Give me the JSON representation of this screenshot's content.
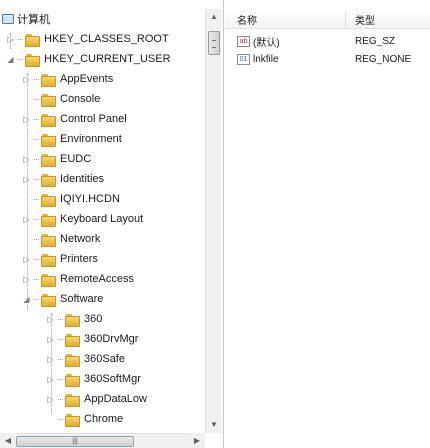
{
  "tree": {
    "root_label": "计算机",
    "items": [
      {
        "label": "HKEY_CLASSES_ROOT",
        "level": 1,
        "twisty": "▷"
      },
      {
        "label": "HKEY_CURRENT_USER",
        "level": 1,
        "twisty": "◢"
      },
      {
        "label": "AppEvents",
        "level": 2,
        "twisty": "▷"
      },
      {
        "label": "Console",
        "level": 2,
        "twisty": ""
      },
      {
        "label": "Control Panel",
        "level": 2,
        "twisty": "▷"
      },
      {
        "label": "Environment",
        "level": 2,
        "twisty": ""
      },
      {
        "label": "EUDC",
        "level": 2,
        "twisty": "▷"
      },
      {
        "label": "Identities",
        "level": 2,
        "twisty": "▷"
      },
      {
        "label": "IQIYI.HCDN",
        "level": 2,
        "twisty": ""
      },
      {
        "label": "Keyboard Layout",
        "level": 2,
        "twisty": "▷"
      },
      {
        "label": "Network",
        "level": 2,
        "twisty": ""
      },
      {
        "label": "Printers",
        "level": 2,
        "twisty": "▷"
      },
      {
        "label": "RemoteAccess",
        "level": 2,
        "twisty": "▷"
      },
      {
        "label": "Software",
        "level": 2,
        "twisty": "◢"
      },
      {
        "label": "360",
        "level": 3,
        "twisty": "▷"
      },
      {
        "label": "360DrvMgr",
        "level": 3,
        "twisty": "▷"
      },
      {
        "label": "360Safe",
        "level": 3,
        "twisty": "▷"
      },
      {
        "label": "360SoftMgr",
        "level": 3,
        "twisty": "▷"
      },
      {
        "label": "AppDataLow",
        "level": 3,
        "twisty": "▷"
      },
      {
        "label": "Chrome",
        "level": 3,
        "twisty": ""
      }
    ],
    "hscroll_grip": "|||"
  },
  "list": {
    "headers": {
      "name": "名称",
      "type": "类型"
    },
    "rows": [
      {
        "name": "(默认)",
        "type": "REG_SZ",
        "icon": "string-value-icon",
        "glyph": "ab"
      },
      {
        "name": "lnkfile",
        "type": "REG_NONE",
        "icon": "binary-value-icon",
        "glyph": "01"
      }
    ]
  },
  "icons": {
    "folder": "folder-icon",
    "computer": "computer-icon",
    "scroll_up": "▲",
    "scroll_down": "▼",
    "scroll_left": "◀",
    "scroll_right": "▶"
  },
  "colors": {
    "folder": "#e2ae33",
    "header_bg": "#f1f3f6",
    "selection_border": "#8aa6c4"
  }
}
